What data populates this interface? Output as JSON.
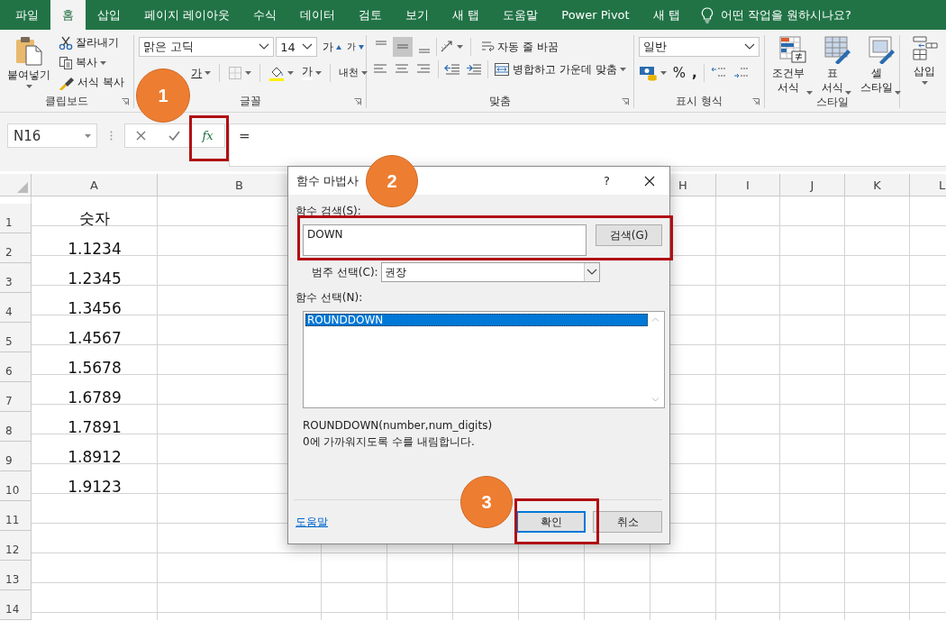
{
  "ribbon": {
    "tabs": [
      {
        "label": "파일",
        "selected": false
      },
      {
        "label": "홈",
        "selected": true
      },
      {
        "label": "삽입",
        "selected": false
      },
      {
        "label": "페이지 레이아웃",
        "selected": false
      },
      {
        "label": "수식",
        "selected": false
      },
      {
        "label": "데이터",
        "selected": false
      },
      {
        "label": "검토",
        "selected": false
      },
      {
        "label": "보기",
        "selected": false
      },
      {
        "label": "새 탭",
        "selected": false
      },
      {
        "label": "도움말",
        "selected": false
      },
      {
        "label": "Power Pivot",
        "selected": false
      },
      {
        "label": "새 탭",
        "selected": false
      }
    ],
    "tell_me": "어떤 작업을 원하시나요?",
    "clipboard": {
      "name": "클립보드",
      "paste": "붙여넣기",
      "cut": "잘라내기",
      "copy": "복사",
      "format_painter": "서식 복사"
    },
    "font": {
      "name": "글꼴",
      "font_name": "맑은 고딕",
      "font_size": "14",
      "grow": "가",
      "shrink": "가",
      "underline": "가",
      "font_color": "가",
      "phonetic": "내천"
    },
    "alignment": {
      "name": "맞춤",
      "vertical_align": [
        {
          "selected": false
        },
        {
          "selected": true
        },
        {
          "selected": false
        }
      ],
      "wrap_text": "자동 줄 바꿈",
      "merge": "병합하고 가운데 맞춤"
    },
    "number": {
      "name": "표시 형식",
      "format": "일반",
      "percent": "%",
      "comma": ","
    },
    "styles": {
      "name": "스타일",
      "conditional": "조건부 서식",
      "table": "표 서식",
      "cell_styles": "셀 스타일"
    },
    "cells": {
      "insert": "삽입"
    }
  },
  "formula_bar": {
    "name_box": "N16",
    "function_button": "fx",
    "formula": "="
  },
  "sheet": {
    "columns": [
      "A",
      "B",
      "H",
      "I",
      "J",
      "K",
      "L"
    ],
    "rows": [
      {
        "number": "1",
        "cells": [
          "숫자"
        ]
      },
      {
        "number": "2",
        "cells": [
          "1.1234"
        ]
      },
      {
        "number": "3",
        "cells": [
          "1.2345"
        ]
      },
      {
        "number": "4",
        "cells": [
          "1.3456"
        ]
      },
      {
        "number": "5",
        "cells": [
          "1.4567"
        ]
      },
      {
        "number": "6",
        "cells": [
          "1.5678"
        ]
      },
      {
        "number": "7",
        "cells": [
          "1.6789"
        ]
      },
      {
        "number": "8",
        "cells": [
          "1.7891"
        ]
      },
      {
        "number": "9",
        "cells": [
          "1.8912"
        ]
      },
      {
        "number": "10",
        "cells": [
          "1.9123"
        ]
      },
      {
        "number": "11"
      },
      {
        "number": "12"
      },
      {
        "number": "13"
      },
      {
        "number": "14"
      }
    ]
  },
  "dialog": {
    "title": "함수 마법사",
    "help_glyph": "?",
    "search_label": "함수 검색(S):",
    "search_value": "DOWN",
    "search_button": "검색(G)",
    "category_label": "범주 선택(C):",
    "category_value": "권장",
    "function_label": "함수 선택(N):",
    "functions": [
      {
        "label": "ROUNDDOWN",
        "selected": true
      }
    ],
    "signature": "ROUNDDOWN(number,num_digits)",
    "description": "0에 가까워지도록 수를 내림합니다.",
    "help_link": "도움말",
    "buttons": [
      {
        "label": "확인",
        "default": true
      },
      {
        "label": "취소",
        "default": false
      }
    ]
  },
  "callouts": [
    {
      "number": "1"
    },
    {
      "number": "2"
    },
    {
      "number": "3"
    }
  ]
}
